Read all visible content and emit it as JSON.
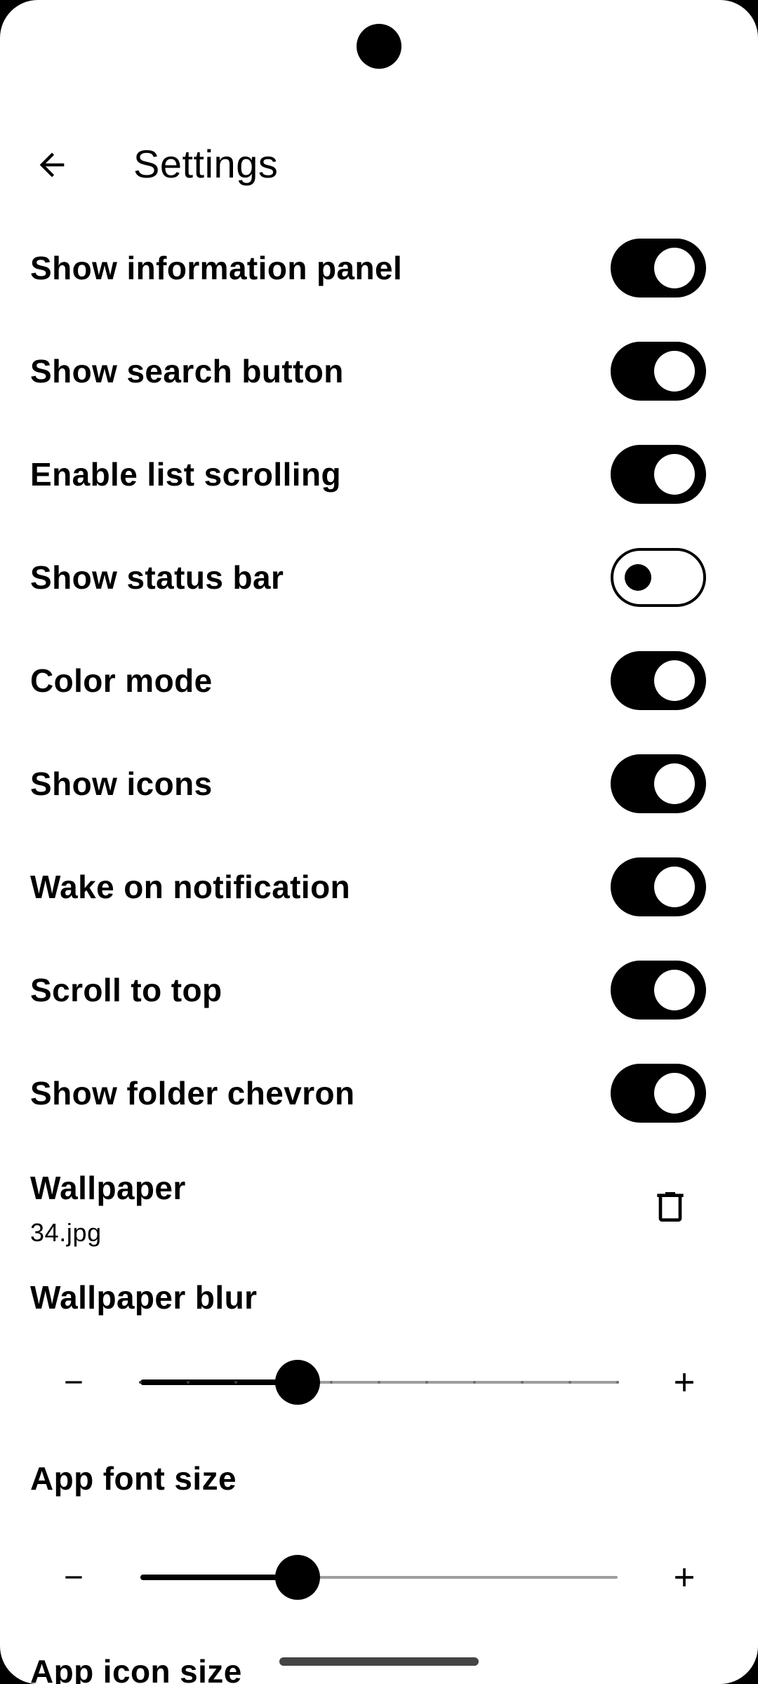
{
  "header": {
    "title": "Settings",
    "back_icon": "arrow-back-icon"
  },
  "toggles": [
    {
      "label": "Show information panel",
      "on": true
    },
    {
      "label": "Show search button",
      "on": true
    },
    {
      "label": "Enable list scrolling",
      "on": true
    },
    {
      "label": "Show status bar",
      "on": false
    },
    {
      "label": "Color mode",
      "on": true
    },
    {
      "label": "Show icons",
      "on": true
    },
    {
      "label": "Wake on notification",
      "on": true
    },
    {
      "label": "Scroll to top",
      "on": true
    },
    {
      "label": "Show folder chevron",
      "on": true
    }
  ],
  "wallpaper": {
    "title": "Wallpaper",
    "value": "34.jpg",
    "delete_icon": "trash-icon"
  },
  "wallpaper_blur": {
    "title": "Wallpaper blur",
    "level": 0.33,
    "steps": 10
  },
  "app_font_size": {
    "title": "App font size",
    "level": 0.33
  },
  "app_icon_size": {
    "title": "App icon size"
  },
  "colors": {
    "accent": "#000000",
    "background": "#ffffff",
    "inactive_track": "#9e9e9e"
  }
}
